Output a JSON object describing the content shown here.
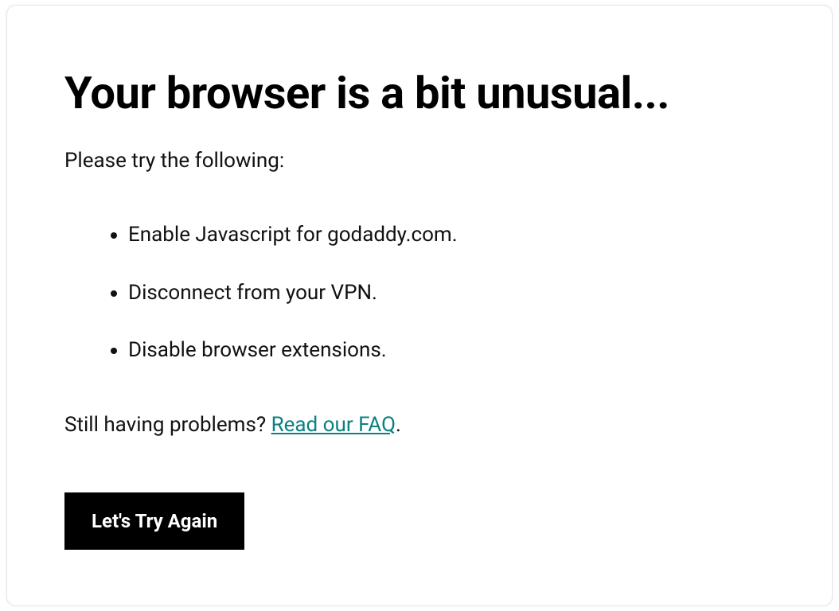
{
  "heading": "Your browser is a bit unusual...",
  "subheading": "Please try the following:",
  "steps": [
    "Enable Javascript for godaddy.com.",
    "Disconnect from your VPN.",
    "Disable browser extensions."
  ],
  "help": {
    "prefix": "Still having problems? ",
    "link_text": "Read our FAQ",
    "suffix": "."
  },
  "retry_button": "Let's Try Again"
}
